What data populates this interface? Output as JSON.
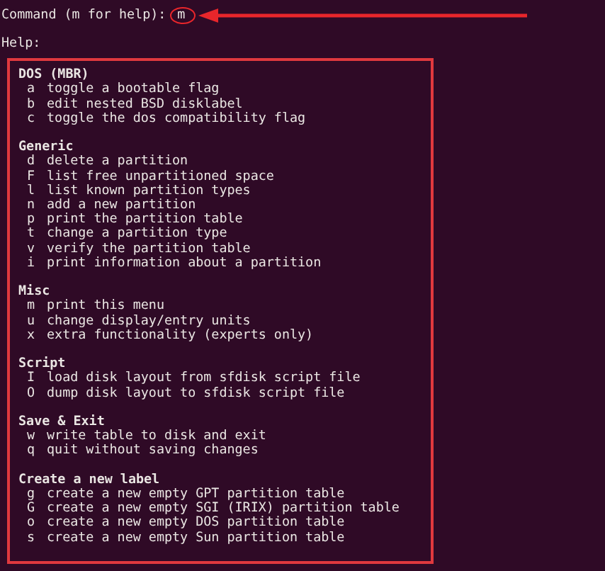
{
  "terminal": {
    "prompt": "Command (m for help):",
    "typed": "m",
    "help_label": "Help:",
    "sections": [
      {
        "title": "DOS (MBR)",
        "commands": [
          {
            "key": "a",
            "description": "toggle a bootable flag"
          },
          {
            "key": "b",
            "description": "edit nested BSD disklabel"
          },
          {
            "key": "c",
            "description": "toggle the dos compatibility flag"
          }
        ]
      },
      {
        "title": "Generic",
        "commands": [
          {
            "key": "d",
            "description": "delete a partition"
          },
          {
            "key": "F",
            "description": "list free unpartitioned space"
          },
          {
            "key": "l",
            "description": "list known partition types"
          },
          {
            "key": "n",
            "description": "add a new partition"
          },
          {
            "key": "p",
            "description": "print the partition table"
          },
          {
            "key": "t",
            "description": "change a partition type"
          },
          {
            "key": "v",
            "description": "verify the partition table"
          },
          {
            "key": "i",
            "description": "print information about a partition"
          }
        ]
      },
      {
        "title": "Misc",
        "commands": [
          {
            "key": "m",
            "description": "print this menu"
          },
          {
            "key": "u",
            "description": "change display/entry units"
          },
          {
            "key": "x",
            "description": "extra functionality (experts only)"
          }
        ]
      },
      {
        "title": "Script",
        "commands": [
          {
            "key": "I",
            "description": "load disk layout from sfdisk script file"
          },
          {
            "key": "O",
            "description": "dump disk layout to sfdisk script file"
          }
        ]
      },
      {
        "title": "Save & Exit",
        "commands": [
          {
            "key": "w",
            "description": "write table to disk and exit"
          },
          {
            "key": "q",
            "description": "quit without saving changes"
          }
        ]
      },
      {
        "title": "Create a new label",
        "commands": [
          {
            "key": "g",
            "description": "create a new empty GPT partition table"
          },
          {
            "key": "G",
            "description": "create a new empty SGI (IRIX) partition table"
          },
          {
            "key": "o",
            "description": "create a new empty DOS partition table"
          },
          {
            "key": "s",
            "description": "create a new empty Sun partition table"
          }
        ]
      }
    ]
  }
}
